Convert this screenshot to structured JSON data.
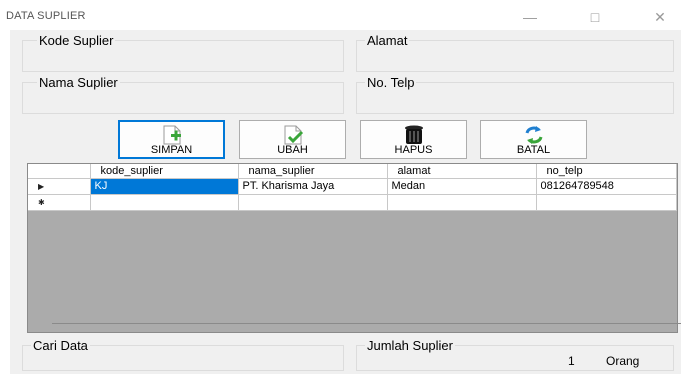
{
  "window": {
    "title": "DATA SUPLIER",
    "minimize": "—",
    "maximize": "□",
    "close": "✕"
  },
  "fields": {
    "kode_suplier_label": "Kode Suplier",
    "alamat_label": "Alamat",
    "nama_suplier_label": "Nama Suplier",
    "no_telp_label": "No. Telp"
  },
  "toolbar": {
    "simpan_label": "SIMPAN",
    "ubah_label": "UBAH",
    "hapus_label": "HAPUS",
    "batal_label": "BATAL"
  },
  "grid": {
    "columns": [
      "kode_suplier",
      "nama_suplier",
      "alamat",
      "no_telp"
    ],
    "rows": [
      {
        "indicator": "▶",
        "cells": [
          "KJ",
          "PT. Kharisma Jaya",
          "Medan",
          "081264789548"
        ]
      },
      {
        "indicator": "✱",
        "cells": [
          "",
          "",
          "",
          ""
        ]
      }
    ]
  },
  "footer": {
    "cari_label": "Cari Data",
    "jumlah_label": "Jumlah Suplier",
    "count": "1",
    "unit": "Orang"
  },
  "colors": {
    "selection": "#0078d7",
    "grid_background": "#ababab",
    "form_background": "#f0f0f0"
  }
}
